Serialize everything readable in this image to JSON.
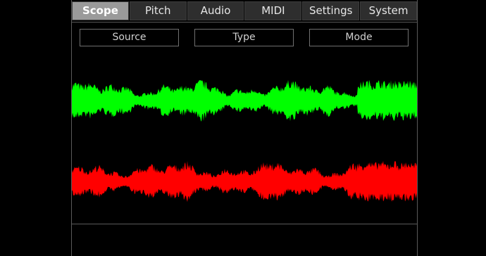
{
  "tabs": [
    {
      "label": "Scope",
      "active": true
    },
    {
      "label": "Pitch",
      "active": false
    },
    {
      "label": "Audio",
      "active": false
    },
    {
      "label": "MIDI",
      "active": false
    },
    {
      "label": "Settings",
      "active": false
    },
    {
      "label": "System",
      "active": false
    }
  ],
  "controls": {
    "source_label": "Source",
    "type_label": "Type",
    "mode_label": "Mode"
  },
  "scope": {
    "channels": [
      {
        "color": "#00ff00"
      },
      {
        "color": "#ff0000"
      }
    ]
  }
}
